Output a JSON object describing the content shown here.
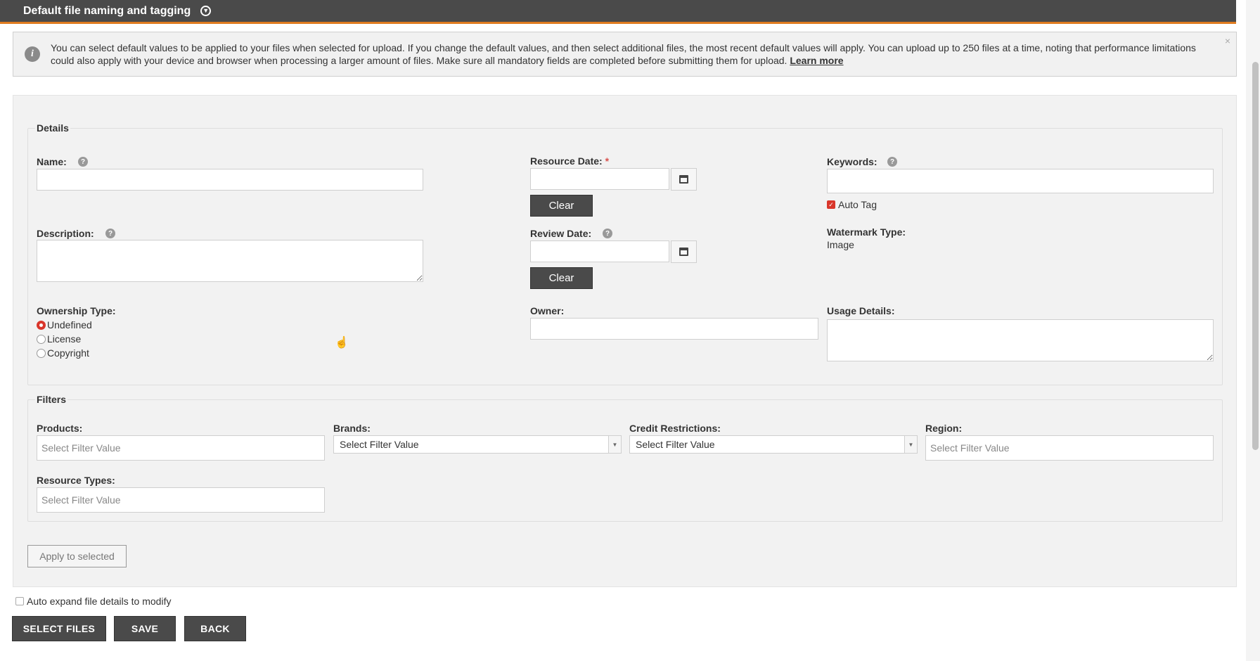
{
  "header": {
    "title": "Default file naming and tagging",
    "toggle_icon": "circle-arrow-down"
  },
  "info": {
    "text": "You can select default values to be applied to your files when selected for upload. If you change the default values, and then select additional files, the most recent default values will apply. You can upload up to 250 files at a time, noting that performance limitations could also apply with your device and browser when processing a larger amount of files. Make sure all mandatory fields are completed before submitting them for upload.",
    "link": "Learn more",
    "close": "×",
    "icon_glyph": "i"
  },
  "details": {
    "legend": "Details",
    "help_glyph": "?",
    "name_label": "Name:",
    "name_value": "",
    "description_label": "Description:",
    "description_value": "",
    "resource_date_label": "Resource Date:",
    "required_mark": "*",
    "resource_date_value": "",
    "review_date_label": "Review Date:",
    "review_date_value": "",
    "clear_label": "Clear",
    "keywords_label": "Keywords:",
    "keywords_value": "",
    "auto_tag_label": "Auto Tag",
    "auto_tag_checked": true,
    "watermark_label": "Watermark Type:",
    "watermark_value": "Image",
    "ownership_label": "Ownership Type:",
    "ownership_options": [
      "Undefined",
      "License",
      "Copyright"
    ],
    "ownership_selected": "Undefined",
    "owner_label": "Owner:",
    "owner_value": "",
    "usage_label": "Usage Details:",
    "usage_value": ""
  },
  "filters": {
    "legend": "Filters",
    "products_label": "Products:",
    "brands_label": "Brands:",
    "credit_label": "Credit Restrictions:",
    "region_label": "Region:",
    "resource_types_label": "Resource Types:",
    "placeholder": "Select Filter Value",
    "dropdown_arrow": "▼"
  },
  "apply_label": "Apply to selected",
  "auto_expand_label": "Auto expand file details to modify",
  "auto_expand_checked": false,
  "buttons": {
    "select_files": "SELECT FILES",
    "save": "SAVE",
    "back": "BACK"
  },
  "colors": {
    "header_bg": "#4a4a4a",
    "accent": "#e07b1f",
    "required": "#d9534f",
    "check": "#d9362b"
  }
}
